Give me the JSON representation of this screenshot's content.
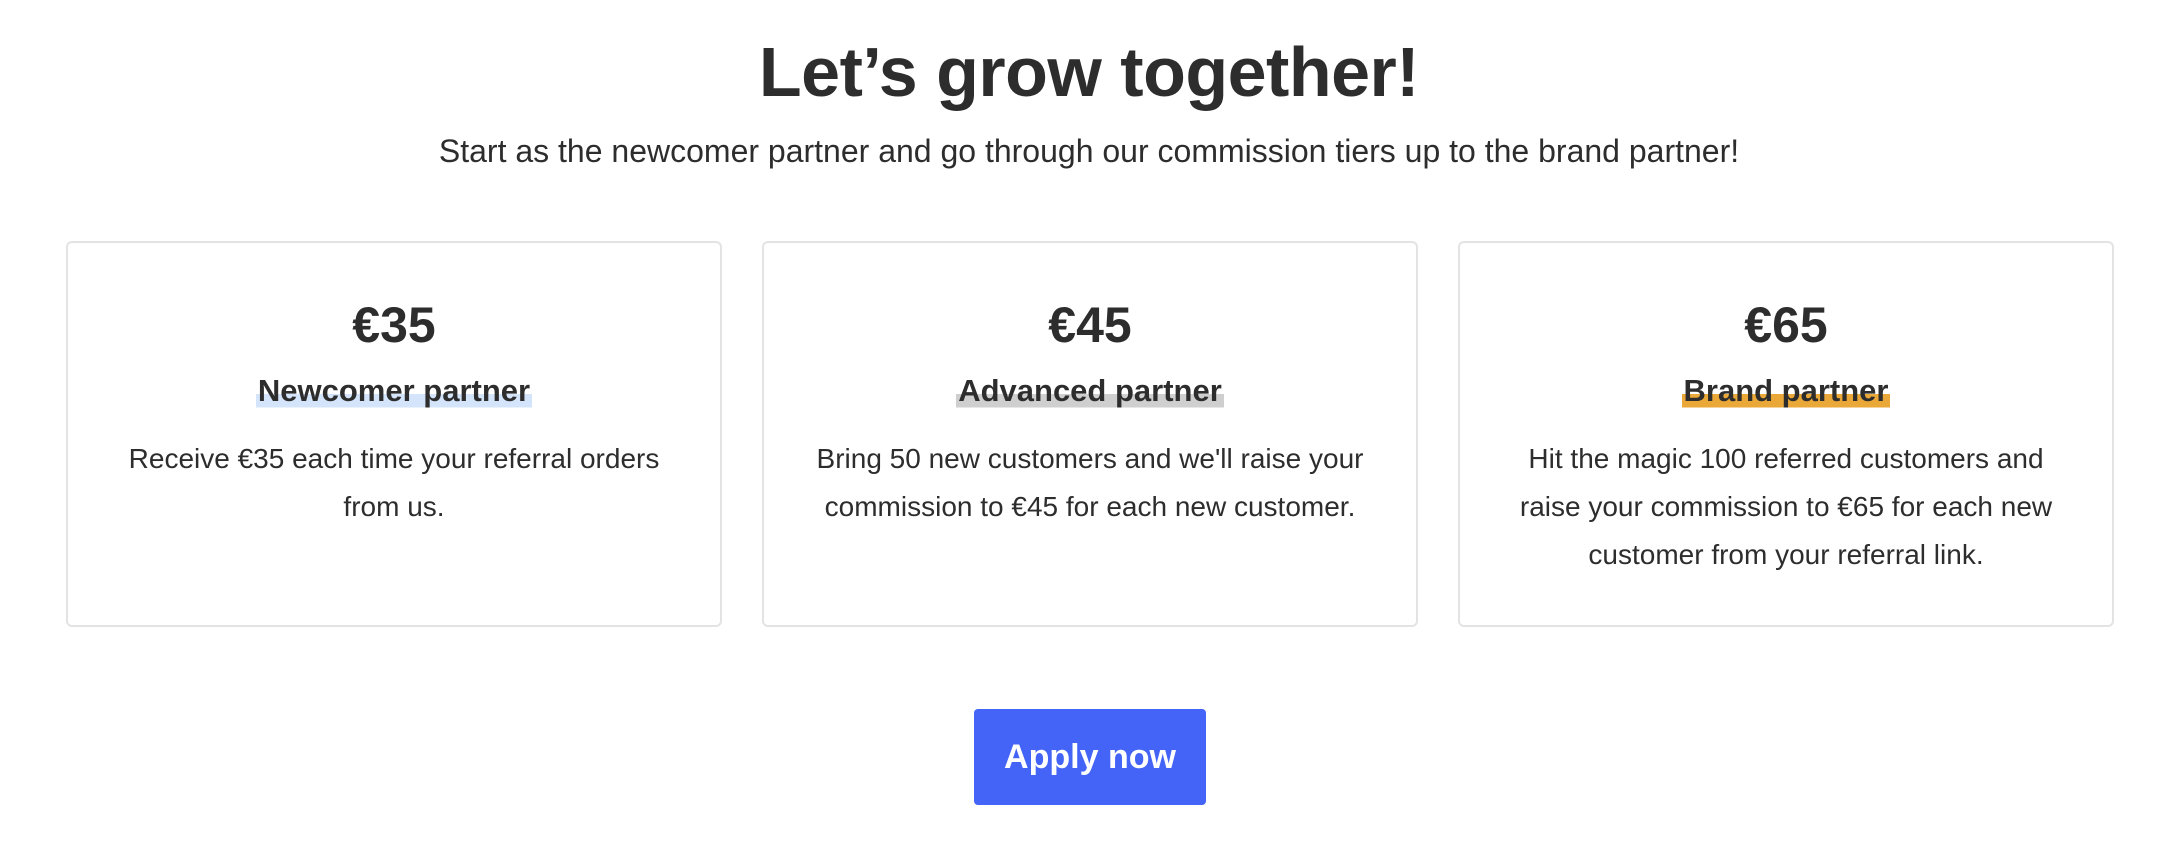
{
  "header": {
    "title": "Let’s grow together!",
    "subtitle": "Start as the newcomer partner and go through our commission tiers up to the brand partner!"
  },
  "tiers": [
    {
      "price": "€35",
      "name": "Newcomer partner",
      "description": "Receive €35 each time your referral orders from us.",
      "highlight_color": "#d4e4fb"
    },
    {
      "price": "€45",
      "name": "Advanced partner",
      "description": "Bring 50 new customers and we'll raise your commission to €45 for each new customer.",
      "highlight_color": "#cfcfcf"
    },
    {
      "price": "€65",
      "name": "Brand partner",
      "description": "Hit the magic 100 referred customers and raise your commission to €65 for each new customer from your referral link.",
      "highlight_color": "#eaa839"
    }
  ],
  "cta": {
    "label": "Apply now",
    "color": "#4364f7"
  }
}
